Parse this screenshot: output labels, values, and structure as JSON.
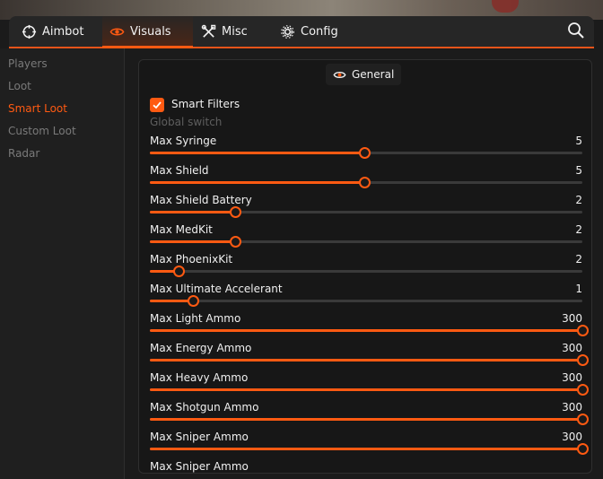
{
  "nav": {
    "tabs": [
      {
        "label": "Aimbot",
        "icon": "crosshair-icon"
      },
      {
        "label": "Visuals",
        "icon": "eye-icon",
        "active": true
      },
      {
        "label": "Misc",
        "icon": "tools-icon"
      },
      {
        "label": "Config",
        "icon": "gear-icon"
      }
    ]
  },
  "sidebar": {
    "items": [
      {
        "label": "Players"
      },
      {
        "label": "Loot"
      },
      {
        "label": "Smart Loot",
        "active": true
      },
      {
        "label": "Custom Loot"
      },
      {
        "label": "Radar"
      }
    ]
  },
  "panel": {
    "title": "General",
    "smart_filters": {
      "label": "Smart Filters",
      "checked": true,
      "sublabel": "Global switch"
    },
    "sliders": [
      {
        "label": "Max Syringe",
        "value": "5",
        "fraction": 0.495
      },
      {
        "label": "Max Shield",
        "value": "5",
        "fraction": 0.495
      },
      {
        "label": "Max Shield Battery",
        "value": "2",
        "fraction": 0.198
      },
      {
        "label": "Max MedKit",
        "value": "2",
        "fraction": 0.198
      },
      {
        "label": "Max PhoenixKit",
        "value": "2",
        "fraction": 0.066
      },
      {
        "label": "Max Ultimate Accelerant",
        "value": "1",
        "fraction": 0.099
      },
      {
        "label": "Max Light Ammo",
        "value": "300",
        "fraction": 1.0
      },
      {
        "label": "Max Energy Ammo",
        "value": "300",
        "fraction": 1.0
      },
      {
        "label": "Max Heavy Ammo",
        "value": "300",
        "fraction": 1.0
      },
      {
        "label": "Max Shotgun Ammo",
        "value": "300",
        "fraction": 1.0
      },
      {
        "label": "Max Sniper Ammo",
        "value": "300",
        "fraction": 1.0
      },
      {
        "label": "Max Sniper Ammo",
        "value": "",
        "fraction": 1.0
      }
    ]
  },
  "colors": {
    "accent": "#ff5a12",
    "background": "#1b1b1b",
    "panel": "#171717",
    "text": "#f0f0f0",
    "muted": "#7a7a7a"
  }
}
